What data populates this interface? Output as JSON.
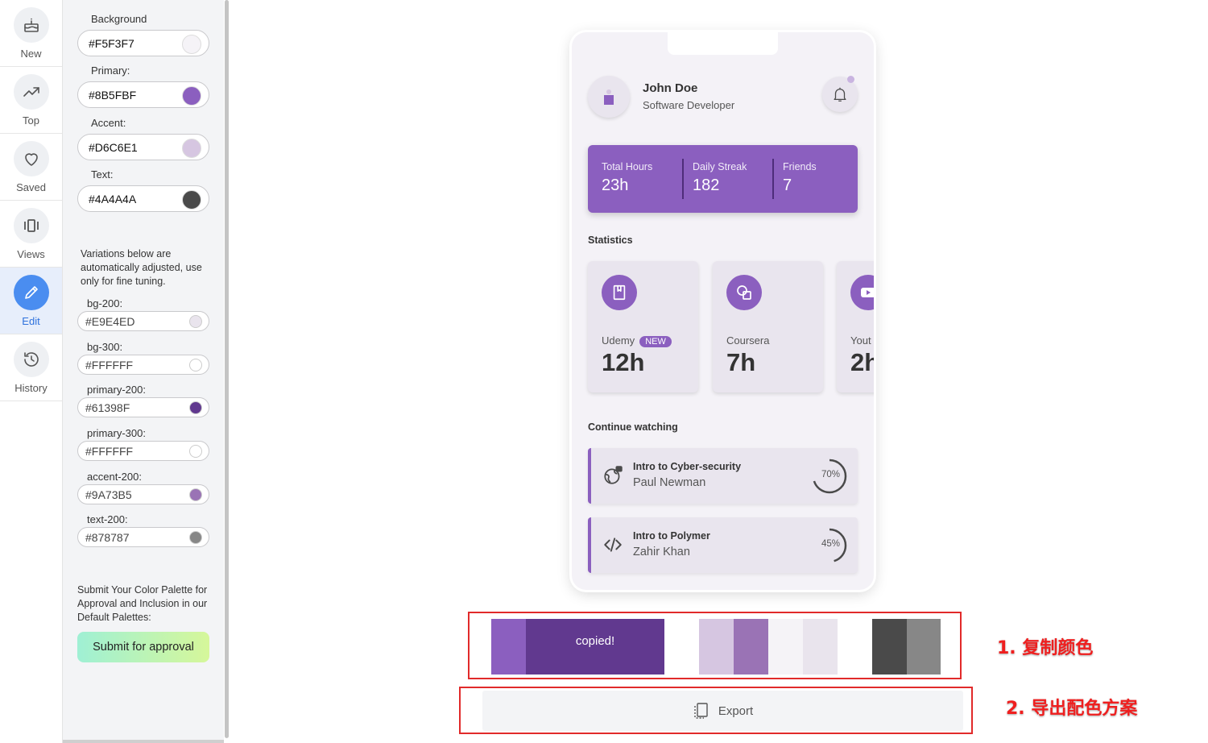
{
  "nav": {
    "items": [
      {
        "label": "New",
        "icon": "cake-icon"
      },
      {
        "label": "Top",
        "icon": "trending-up-icon"
      },
      {
        "label": "Saved",
        "icon": "heart-icon"
      },
      {
        "label": "Views",
        "icon": "carousel-icon"
      },
      {
        "label": "Edit",
        "icon": "pencil-icon",
        "active": true
      },
      {
        "label": "History",
        "icon": "history-icon"
      }
    ]
  },
  "editor": {
    "background": {
      "label": "Background",
      "value": "#F5F3F7",
      "swatch": "#F5F3F7"
    },
    "primary": {
      "label": "Primary:",
      "value": "#8B5FBF",
      "swatch": "#8B5FBF"
    },
    "accent": {
      "label": "Accent:",
      "value": "#D6C6E1",
      "swatch": "#D6C6E1"
    },
    "text": {
      "label": "Text:",
      "value": "#4A4A4A",
      "swatch": "#4A4A4A"
    },
    "note": "Variations below are automatically adjusted, use only for fine tuning.",
    "variations": [
      {
        "label": "bg-200:",
        "value": "#E9E4ED",
        "swatch": "#E9E4ED"
      },
      {
        "label": "bg-300:",
        "value": "#FFFFFF",
        "swatch": "#FFFFFF"
      },
      {
        "label": "primary-200:",
        "value": "#61398F",
        "swatch": "#61398F"
      },
      {
        "label": "primary-300:",
        "value": "#FFFFFF",
        "swatch": "#FFFFFF"
      },
      {
        "label": "accent-200:",
        "value": "#9A73B5",
        "swatch": "#9A73B5"
      },
      {
        "label": "text-200:",
        "value": "#878787",
        "swatch": "#878787"
      }
    ],
    "submit_note": "Submit Your Color Palette for Approval and Inclusion in our Default Palettes:",
    "submit_label": "Submit for approval"
  },
  "preview": {
    "user": {
      "name": "John Doe",
      "role": "Software Developer"
    },
    "stats": [
      {
        "key": "Total Hours",
        "value": "23h"
      },
      {
        "key": "Daily Streak",
        "value": "182"
      },
      {
        "key": "Friends",
        "value": "7"
      }
    ],
    "statistics_title": "Statistics",
    "cards": [
      {
        "name": "Udemy",
        "badge": "NEW",
        "hours": "12h",
        "icon": "book-icon"
      },
      {
        "name": "Coursera",
        "hours": "7h",
        "icon": "shapes-icon"
      },
      {
        "name": "Yout",
        "hours": "2h",
        "icon": "youtube-icon"
      }
    ],
    "continue_title": "Continue watching",
    "courses": [
      {
        "title": "Intro to Cyber-security",
        "author": "Paul Newman",
        "progress": "70%",
        "icon": "globe-lock-icon"
      },
      {
        "title": "Intro to Polymer",
        "author": "Zahir Khan",
        "progress": "45%",
        "icon": "code-icon"
      }
    ]
  },
  "palette": {
    "copied_label": "copied!",
    "swatches": [
      "#8B5FBF",
      "#61398F",
      "#FFFFFF",
      "#D6C6E1",
      "#9A73B5",
      "#F5F3F7",
      "#E9E4ED",
      "#FFFFFF",
      "#4A4A4A",
      "#878787"
    ]
  },
  "export_label": "Export",
  "annotations": {
    "step1": "1. 复制颜色",
    "step2": "2. 导出配色方案"
  }
}
